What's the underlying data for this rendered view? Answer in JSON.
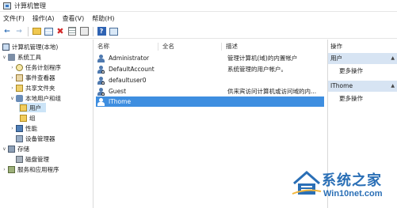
{
  "window": {
    "title": "计算机管理"
  },
  "menu": [
    "文件(F)",
    "操作(A)",
    "查看(V)",
    "帮助(H)"
  ],
  "toolbar": {
    "icons": [
      "back-icon",
      "forward-icon",
      "up-folder-icon",
      "grid-view-icon",
      "delete-icon",
      "properties-icon",
      "refresh-icon",
      "help-icon",
      "console-icon"
    ]
  },
  "tree": {
    "root": "计算机管理(本地)",
    "system_tools": "系统工具",
    "task_scheduler": "任务计划程序",
    "event_viewer": "事件查看器",
    "shared_folders": "共享文件夹",
    "local_users_groups": "本地用户和组",
    "users": "用户",
    "groups": "组",
    "performance": "性能",
    "device_manager": "设备管理器",
    "storage": "存储",
    "disk_management": "磁盘管理",
    "services_apps": "服务和应用程序"
  },
  "list": {
    "columns": {
      "name": "名称",
      "fullname": "全名",
      "description": "描述"
    },
    "rows": [
      {
        "name": "Administrator",
        "description": "管理计算机(域)的内置帐户"
      },
      {
        "name": "DefaultAccount",
        "description": "系统管理的用户帐户。"
      },
      {
        "name": "defaultuser0",
        "description": ""
      },
      {
        "name": "Guest",
        "description": "供来宾访问计算机或访问域的内..."
      },
      {
        "name": "IThome",
        "description": ""
      }
    ],
    "selected_row": "IThome"
  },
  "actions": {
    "title": "操作",
    "group1": "用户",
    "group1_more": "更多操作",
    "group2": "IThome",
    "group2_more": "更多操作"
  },
  "watermark": {
    "title": "系统之家",
    "url": "Win10net.com"
  }
}
